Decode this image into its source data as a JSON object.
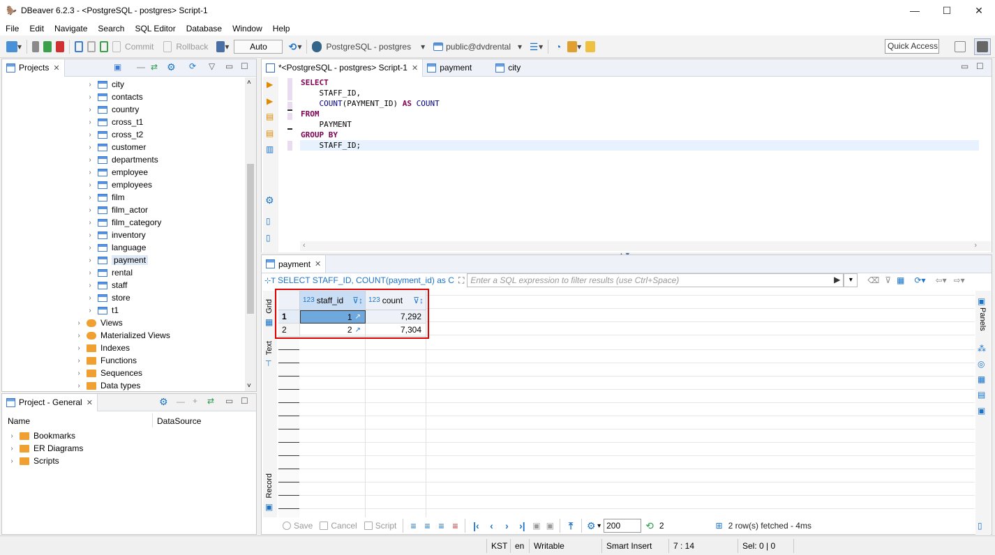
{
  "window": {
    "title": "DBeaver 6.2.3 - <PostgreSQL - postgres> Script-1",
    "minimize": "—",
    "maximize": "☐",
    "close": "✕"
  },
  "menu": [
    "File",
    "Edit",
    "Navigate",
    "Search",
    "SQL Editor",
    "Database",
    "Window",
    "Help"
  ],
  "toolbar": {
    "commit": "Commit",
    "rollback": "Rollback",
    "auto": "Auto",
    "connection": "PostgreSQL - postgres",
    "schema": "public@dvdrental",
    "quick_access": "Quick Access"
  },
  "projects": {
    "tab_label": "Projects",
    "tables": [
      "city",
      "contacts",
      "country",
      "cross_t1",
      "cross_t2",
      "customer",
      "departments",
      "employee",
      "employees",
      "film",
      "film_actor",
      "film_category",
      "inventory",
      "language",
      "payment",
      "rental",
      "staff",
      "store",
      "t1"
    ],
    "selected": "payment",
    "folders": [
      {
        "label": "Views",
        "icon": "eye"
      },
      {
        "label": "Materialized Views",
        "icon": "eye"
      },
      {
        "label": "Indexes",
        "icon": "folder"
      },
      {
        "label": "Functions",
        "icon": "folder"
      },
      {
        "label": "Sequences",
        "icon": "folder"
      },
      {
        "label": "Data types",
        "icon": "folder"
      }
    ]
  },
  "project_general": {
    "tab_label": "Project - General",
    "col_name": "Name",
    "col_datasource": "DataSource",
    "items": [
      "Bookmarks",
      "ER Diagrams",
      "Scripts"
    ]
  },
  "editor": {
    "tabs": [
      {
        "label": "*<PostgreSQL - postgres> Script-1",
        "active": true
      },
      {
        "label": "payment",
        "active": false
      },
      {
        "label": "city",
        "active": false
      }
    ],
    "code": {
      "l1": "SELECT",
      "l2": "    STAFF_ID,",
      "l3_fn": "COUNT",
      "l3_rest": "(PAYMENT_ID) ",
      "l3_as": "AS",
      "l3_count": " COUNT",
      "l4": "FROM",
      "l5": "    PAYMENT",
      "l6": "GROUP BY",
      "l7": "    STAFF_ID;"
    }
  },
  "results": {
    "tab_label": "payment",
    "query_text": "SELECT STAFF_ID, COUNT(payment_id) as C",
    "filter_placeholder": "Enter a SQL expression to filter results (use Ctrl+Space)",
    "columns": [
      {
        "type": "123",
        "name": "staff_id"
      },
      {
        "type": "123",
        "name": "count"
      }
    ],
    "rows": [
      {
        "num": "1",
        "staff_id": "1",
        "count": "7,292"
      },
      {
        "num": "2",
        "staff_id": "2",
        "count": "7,304"
      }
    ],
    "side_labels": {
      "grid": "Grid",
      "text": "Text",
      "record": "Record",
      "panels": "Panels"
    },
    "bottom": {
      "save": "Save",
      "cancel": "Cancel",
      "script": "Script",
      "fetch_size": "200",
      "refresh_count": "2",
      "status": "2 row(s) fetched - 4ms"
    }
  },
  "statusbar": {
    "tz": "KST",
    "lang": "en",
    "mode": "Writable",
    "insert": "Smart Insert",
    "pos": "7 : 14",
    "sel": "Sel: 0 | 0"
  },
  "colors": {
    "highlight_box": "#e00000",
    "keyword": "#7f0055",
    "selection": "#6fa8dc"
  }
}
